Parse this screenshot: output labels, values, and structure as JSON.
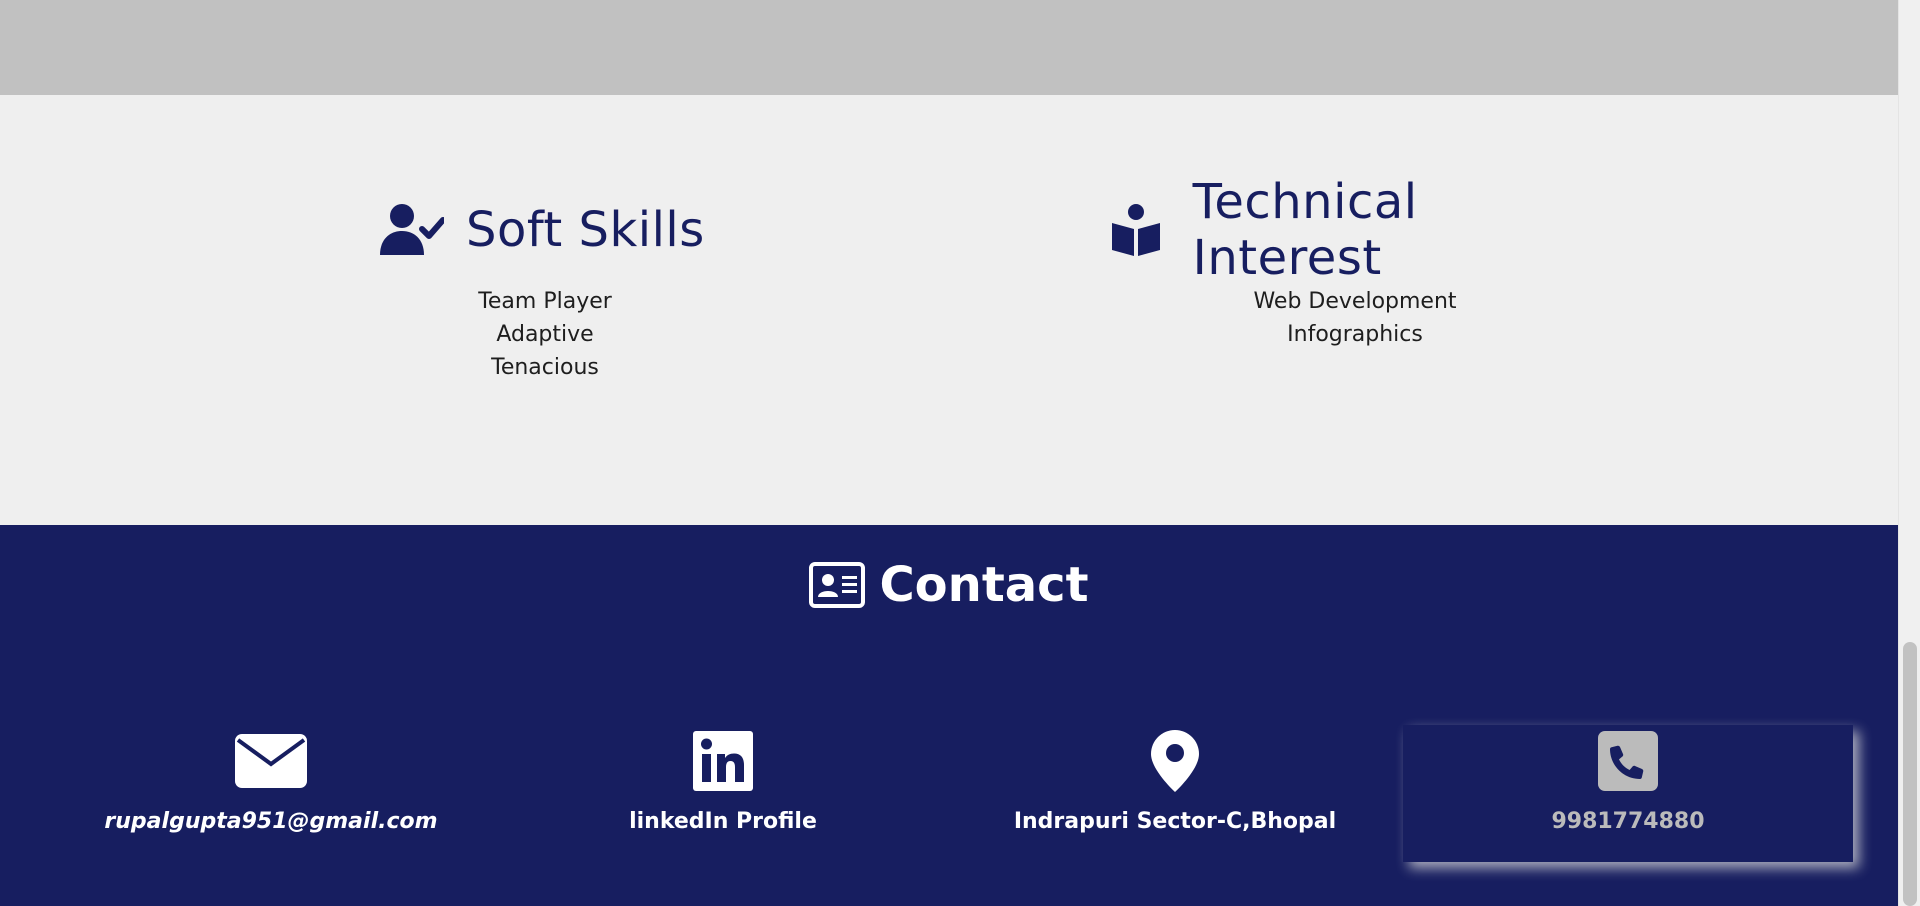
{
  "soft_skills": {
    "title": "Soft Skills",
    "icon": "user-check-icon",
    "items": [
      "Team Player",
      "Adaptive",
      "Tenacious"
    ]
  },
  "technical_interest": {
    "title": "Technical Interest",
    "icon": "book-reader-icon",
    "items": [
      "Web Development",
      "Infographics"
    ]
  },
  "contact": {
    "title": "Contact",
    "icon": "address-card-icon",
    "email": {
      "label": "rupalgupta951@gmail.com",
      "icon": "envelope-icon"
    },
    "linkedin": {
      "label": "linkedIn Profile",
      "icon": "linkedin-icon"
    },
    "location": {
      "label": "Indrapuri Sector-C,Bhopal",
      "icon": "map-marker-icon"
    },
    "phone": {
      "label": "9981774880",
      "icon": "phone-square-icon"
    }
  },
  "colors": {
    "navy": "#171e60",
    "light_bg": "#efefef",
    "grey_band": "#c1c1c1"
  }
}
